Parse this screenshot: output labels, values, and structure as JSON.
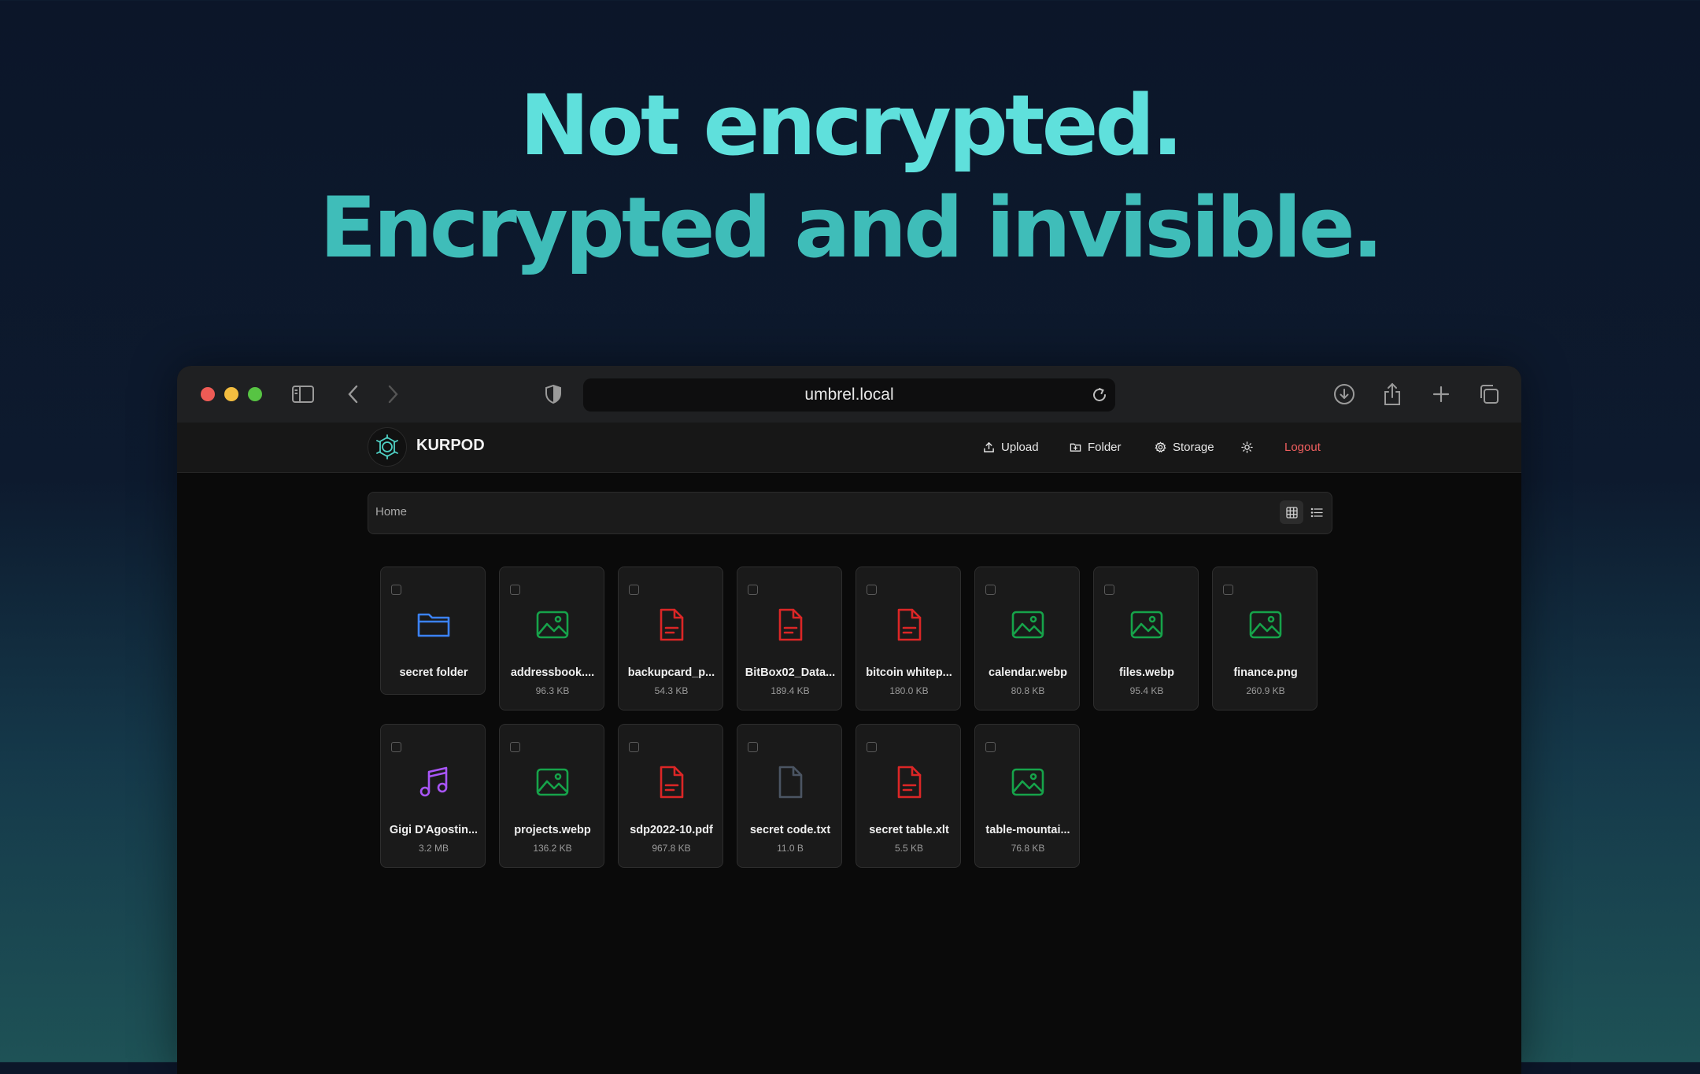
{
  "hero": {
    "line1": "Not encrypted.",
    "line2": "Encrypted and invisible."
  },
  "browser": {
    "url": "umbrel.local",
    "icons": [
      "sidebar-icon",
      "back-icon",
      "forward-icon",
      "shield-icon",
      "reload-icon",
      "download-icon",
      "share-icon",
      "new-tab-icon",
      "tabs-icon"
    ]
  },
  "app": {
    "brand": "KURPOD",
    "nav": {
      "upload": "Upload",
      "folder": "Folder",
      "storage": "Storage",
      "logout": "Logout"
    },
    "breadcrumb": "Home",
    "view_modes": [
      "grid",
      "list"
    ],
    "active_view": "grid"
  },
  "colors": {
    "folder": "#3b82f6",
    "image": "#16a34a",
    "document": "#dc2626",
    "audio": "#a855f7",
    "text": "#4b5563",
    "logout": "#f05f5f",
    "hero_top": "#5fe0dc",
    "hero_bottom": "#3fbdb9"
  },
  "files": [
    {
      "name": "secret folder",
      "size": "",
      "type": "folder"
    },
    {
      "name": "addressbook....",
      "size": "96.3 KB",
      "type": "image"
    },
    {
      "name": "backupcard_p...",
      "size": "54.3 KB",
      "type": "document"
    },
    {
      "name": "BitBox02_Data...",
      "size": "189.4 KB",
      "type": "document"
    },
    {
      "name": "bitcoin whitep...",
      "size": "180.0 KB",
      "type": "document"
    },
    {
      "name": "calendar.webp",
      "size": "80.8 KB",
      "type": "image"
    },
    {
      "name": "files.webp",
      "size": "95.4 KB",
      "type": "image"
    },
    {
      "name": "finance.png",
      "size": "260.9 KB",
      "type": "image"
    },
    {
      "name": "Gigi D'Agostin...",
      "size": "3.2 MB",
      "type": "audio"
    },
    {
      "name": "projects.webp",
      "size": "136.2 KB",
      "type": "image"
    },
    {
      "name": "sdp2022-10.pdf",
      "size": "967.8 KB",
      "type": "document"
    },
    {
      "name": "secret code.txt",
      "size": "11.0 B",
      "type": "text"
    },
    {
      "name": "secret table.xlt",
      "size": "5.5 KB",
      "type": "document"
    },
    {
      "name": "table-mountai...",
      "size": "76.8 KB",
      "type": "image"
    }
  ]
}
